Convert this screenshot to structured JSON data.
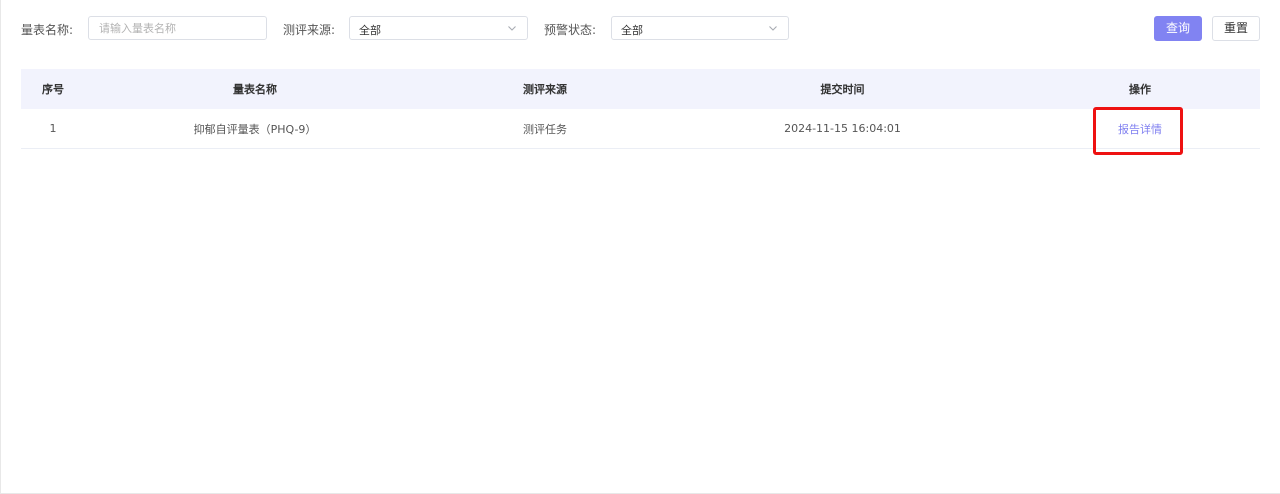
{
  "filters": {
    "scale_name_label": "量表名称:",
    "scale_name_placeholder": "请输入量表名称",
    "scale_name_value": "",
    "source_label": "测评来源:",
    "source_value": "全部",
    "warning_label": "预警状态:",
    "warning_value": "全部",
    "query_label": "查询",
    "reset_label": "重置"
  },
  "table": {
    "headers": [
      "序号",
      "量表名称",
      "测评来源",
      "提交时间",
      "操作"
    ],
    "rows": [
      {
        "index": "1",
        "scale_name": "抑郁自评量表（PHQ-9）",
        "source": "测评任务",
        "submit_time": "2024-11-15 16:04:01",
        "action": "报告详情"
      }
    ]
  },
  "colors": {
    "primary": "#8183f2",
    "link": "#7f7ff0",
    "header_bg": "#f2f3fd",
    "highlight": "#ee1111"
  },
  "icons": {
    "select_arrow": "chevron-down-icon"
  }
}
